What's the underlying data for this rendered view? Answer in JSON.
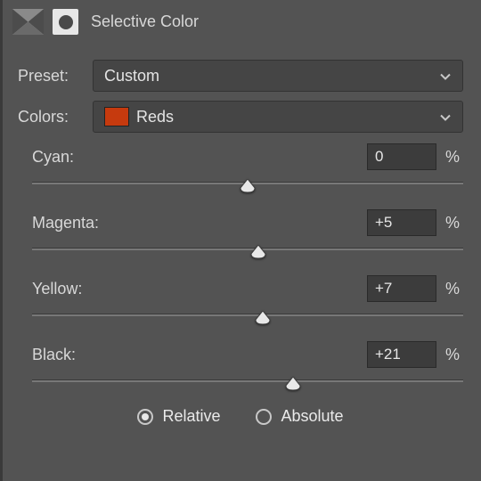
{
  "header": {
    "title": "Selective Color"
  },
  "preset": {
    "label": "Preset:",
    "value": "Custom"
  },
  "colors": {
    "label": "Colors:",
    "value": "Reds",
    "swatch": "#c63a0e"
  },
  "sliders": [
    {
      "name": "Cyan:",
      "value": "0",
      "pos": 50
    },
    {
      "name": "Magenta:",
      "value": "+5",
      "pos": 52.5
    },
    {
      "name": "Yellow:",
      "value": "+7",
      "pos": 53.5
    },
    {
      "name": "Black:",
      "value": "+21",
      "pos": 60.5
    }
  ],
  "unit": "%",
  "mode": {
    "relative": "Relative",
    "absolute": "Absolute",
    "selected": "relative"
  }
}
